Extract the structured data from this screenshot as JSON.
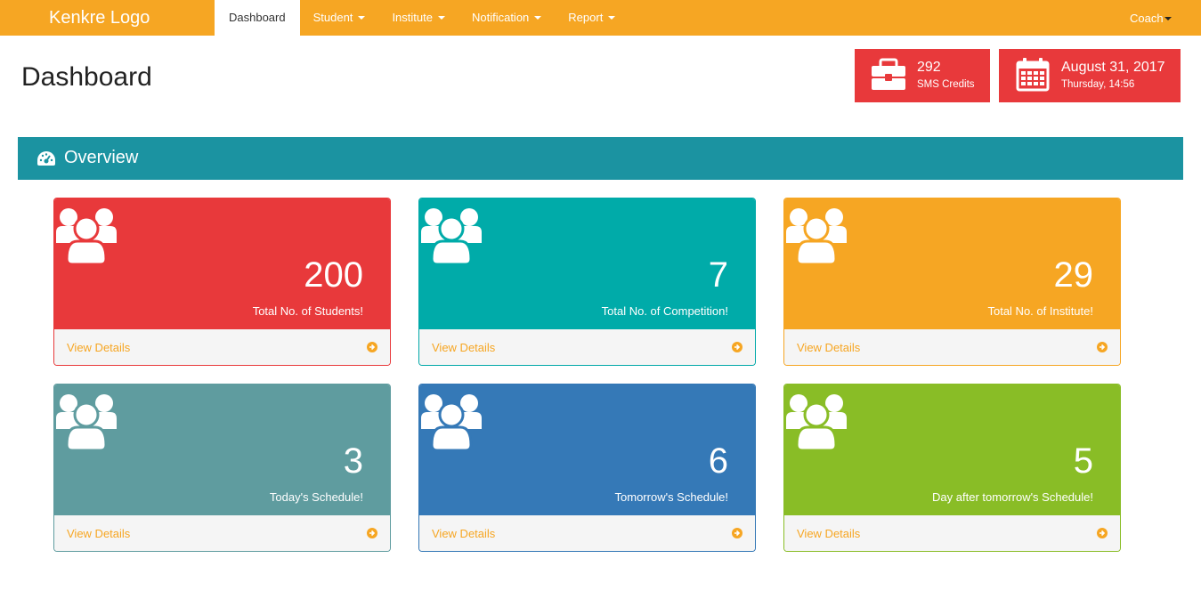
{
  "navbar": {
    "brand": "Kenkre Logo",
    "items": [
      {
        "label": "Dashboard"
      },
      {
        "label": "Student"
      },
      {
        "label": "Institute"
      },
      {
        "label": "Notification"
      },
      {
        "label": "Report"
      }
    ],
    "user_menu": "Coach",
    "background": "#f6a623"
  },
  "page": {
    "title": "Dashboard"
  },
  "info_boxes": {
    "sms": {
      "value": "292",
      "label": "SMS Credits",
      "icon": "briefcase-icon"
    },
    "date": {
      "value": "August 31, 2017",
      "label": "Thursday, 14:56",
      "icon": "calendar-icon"
    },
    "color": "#e8393b"
  },
  "overview": {
    "title": "Overview",
    "icon": "dashboard-icon",
    "color": "#1b93a1"
  },
  "cards": [
    {
      "count": "200",
      "label": "Total No. of Students!",
      "link": "View Details",
      "color": "#e8393b",
      "icon": "users-icon"
    },
    {
      "count": "7",
      "label": "Total No. of Competition!",
      "link": "View Details",
      "color": "#00aba9",
      "icon": "users-icon"
    },
    {
      "count": "29",
      "label": "Total No. of Institute!",
      "link": "View Details",
      "color": "#f6a623",
      "icon": "users-icon"
    },
    {
      "count": "3",
      "label": "Today's Schedule!",
      "link": "View Details",
      "color": "#5f9c9f",
      "icon": "users-icon"
    },
    {
      "count": "6",
      "label": "Tomorrow's Schedule!",
      "link": "View Details",
      "color": "#3579b7",
      "icon": "users-icon"
    },
    {
      "count": "5",
      "label": "Day after tomorrow's Schedule!",
      "link": "View Details",
      "color": "#89bd26",
      "icon": "users-icon"
    }
  ]
}
